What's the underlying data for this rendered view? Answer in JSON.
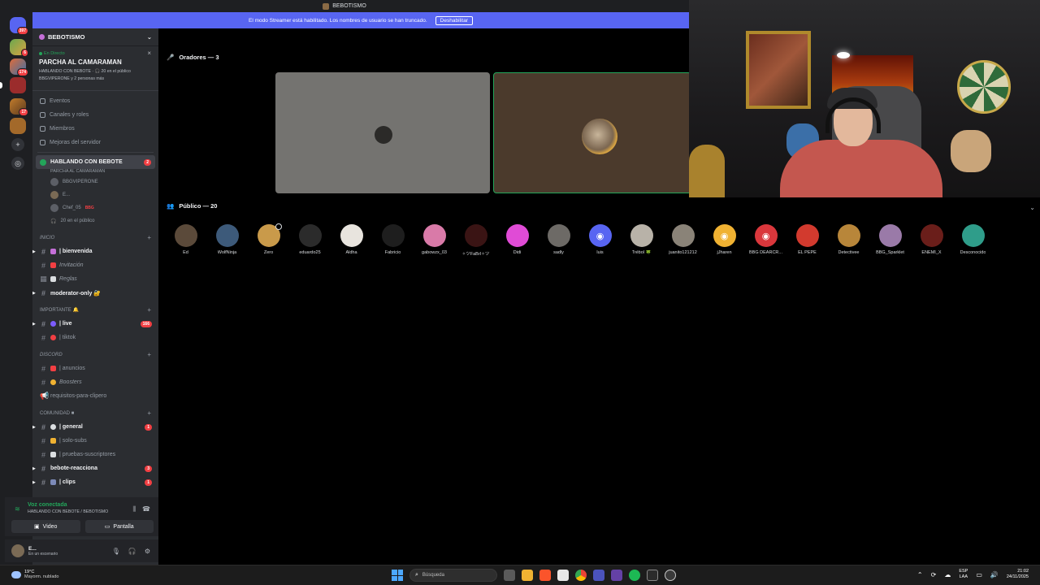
{
  "window": {
    "title": "BEBOTISMO"
  },
  "streamer_banner": {
    "text": "El modo Streamer está habilitado. Los nombres de usuario se han truncado.",
    "button": "Deshabilitar"
  },
  "server_rail": {
    "badges": [
      "397",
      "6",
      "174",
      "17"
    ]
  },
  "sidebar": {
    "server_name": "BEBOTISMO",
    "event": {
      "status": "En Directo",
      "title": "PARCHA AL CAMARAMAN",
      "meta": "HABLANDO CON BEBOTE · 🎧 20 en el público",
      "participants": "BBGVIPERONE y 2 personas más"
    },
    "menu": [
      "Eventos",
      "Canales y roles",
      "Miembros",
      "Mejoras del servidor"
    ],
    "voice_channel": {
      "name": "HABLANDO CON BEBOTE",
      "badge": "2",
      "subtitle": "PARCHA AL CAMARAMAN",
      "users": [
        {
          "name": "BBGVIPERONE",
          "tag": ""
        },
        {
          "name": "E...",
          "tag": ""
        },
        {
          "name": "Chef_05",
          "tag": "BBG"
        }
      ],
      "audience_line": "20 en el público"
    },
    "categories": [
      {
        "name": "INICIO",
        "channels": [
          {
            "name": "| bienvenida",
            "unread": true,
            "badge": ""
          },
          {
            "name": "Invitación",
            "unread": false,
            "badge": ""
          },
          {
            "name": "Reglas",
            "unread": false,
            "badge": ""
          },
          {
            "name": "moderator-only 🔐",
            "unread": true,
            "badge": ""
          }
        ]
      },
      {
        "name": "IMPORTANTE 🔔",
        "channels": [
          {
            "name": "| live",
            "unread": true,
            "badge": "166"
          },
          {
            "name": "| tiktok",
            "unread": false,
            "badge": ""
          }
        ]
      },
      {
        "name": "DISCORD",
        "channels": [
          {
            "name": "| anuncios",
            "unread": false,
            "badge": ""
          },
          {
            "name": "Boosters",
            "unread": false,
            "badge": ""
          },
          {
            "name": "requisitos-para-clipero",
            "unread": false,
            "badge": ""
          }
        ]
      },
      {
        "name": "COMUNIDAD ■",
        "channels": [
          {
            "name": "| general",
            "unread": true,
            "badge": "1"
          },
          {
            "name": "| solo-subs",
            "unread": false,
            "badge": ""
          },
          {
            "name": "| pruebas-suscriptores",
            "unread": false,
            "badge": ""
          },
          {
            "name": "bebote-reacciona",
            "unread": true,
            "badge": "3"
          },
          {
            "name": "| clips",
            "unread": true,
            "badge": "1"
          }
        ]
      }
    ],
    "voice_status": {
      "title": "Voz conectada",
      "location": "HABLANDO CON BEBOTE / BEBOTISMO",
      "video_btn": "Video",
      "screen_btn": "Pantalla"
    },
    "user": {
      "name": "E...",
      "status": "En un escenario"
    }
  },
  "stage": {
    "speakers_label": "Oradores — 3",
    "audience_label": "Público — 20",
    "audience": [
      {
        "name": "Ed",
        "color": "#5b4a3a"
      },
      {
        "name": "WolfNinja",
        "color": "#3d5a7a"
      },
      {
        "name": "Zero",
        "color": "#c99a4a"
      },
      {
        "name": "eduardo25",
        "color": "#2b2b2b"
      },
      {
        "name": "Aldha",
        "color": "#e8e4de"
      },
      {
        "name": "Fabricio",
        "color": "#1e1e1e"
      },
      {
        "name": "gabowzx_03",
        "color": "#d97aa8"
      },
      {
        "name": "✧ツFaBrI✧ツ",
        "color": "#3a1414"
      },
      {
        "name": "Didi",
        "color": "#e04bd6"
      },
      {
        "name": "sadly",
        "color": "#6d6a66"
      },
      {
        "name": "luis",
        "color": "#5865f2"
      },
      {
        "name": "Trébol 🍀",
        "color": "#b8b2a8"
      },
      {
        "name": "juanito121212",
        "color": "#8a8378"
      },
      {
        "name": "jJharen",
        "color": "#f0b232"
      },
      {
        "name": "BBG DEARCR...",
        "color": "#da373c"
      },
      {
        "name": "EL PEPE",
        "color": "#d23a2e"
      },
      {
        "name": "Detectivee",
        "color": "#b8863a"
      },
      {
        "name": "BBG_Sparklet",
        "color": "#9a7aa8"
      },
      {
        "name": "ENEMI_X",
        "color": "#6a1e1a"
      },
      {
        "name": "Desconocido",
        "color": "#2f9d8a"
      }
    ]
  },
  "taskbar": {
    "temp": "19°C",
    "condition": "Mayorm. nublado",
    "search_placeholder": "Búsqueda",
    "lang_top": "ESP",
    "lang_bottom": "LAA",
    "time": "21:02",
    "date": "24/11/2025"
  }
}
